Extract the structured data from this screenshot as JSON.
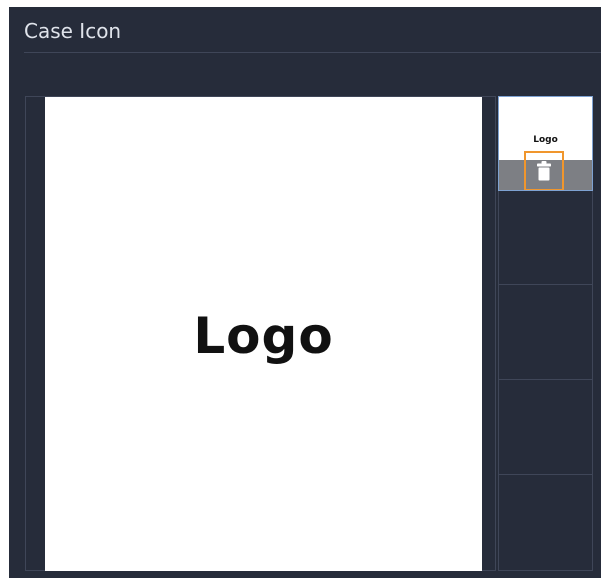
{
  "dialog": {
    "title": "Case Icon"
  },
  "preview": {
    "logo_text": "Logo"
  },
  "thumbnails": {
    "selected_label": "Logo",
    "slot_count": 5
  },
  "actions": {
    "delete_icon": "trash-icon",
    "highlight_color": "#f0962d"
  },
  "colors": {
    "panel_bg": "#262c3a",
    "divider": "#3f4658",
    "selection_border": "#7ea2d2",
    "action_bar": "#7d7f84"
  }
}
